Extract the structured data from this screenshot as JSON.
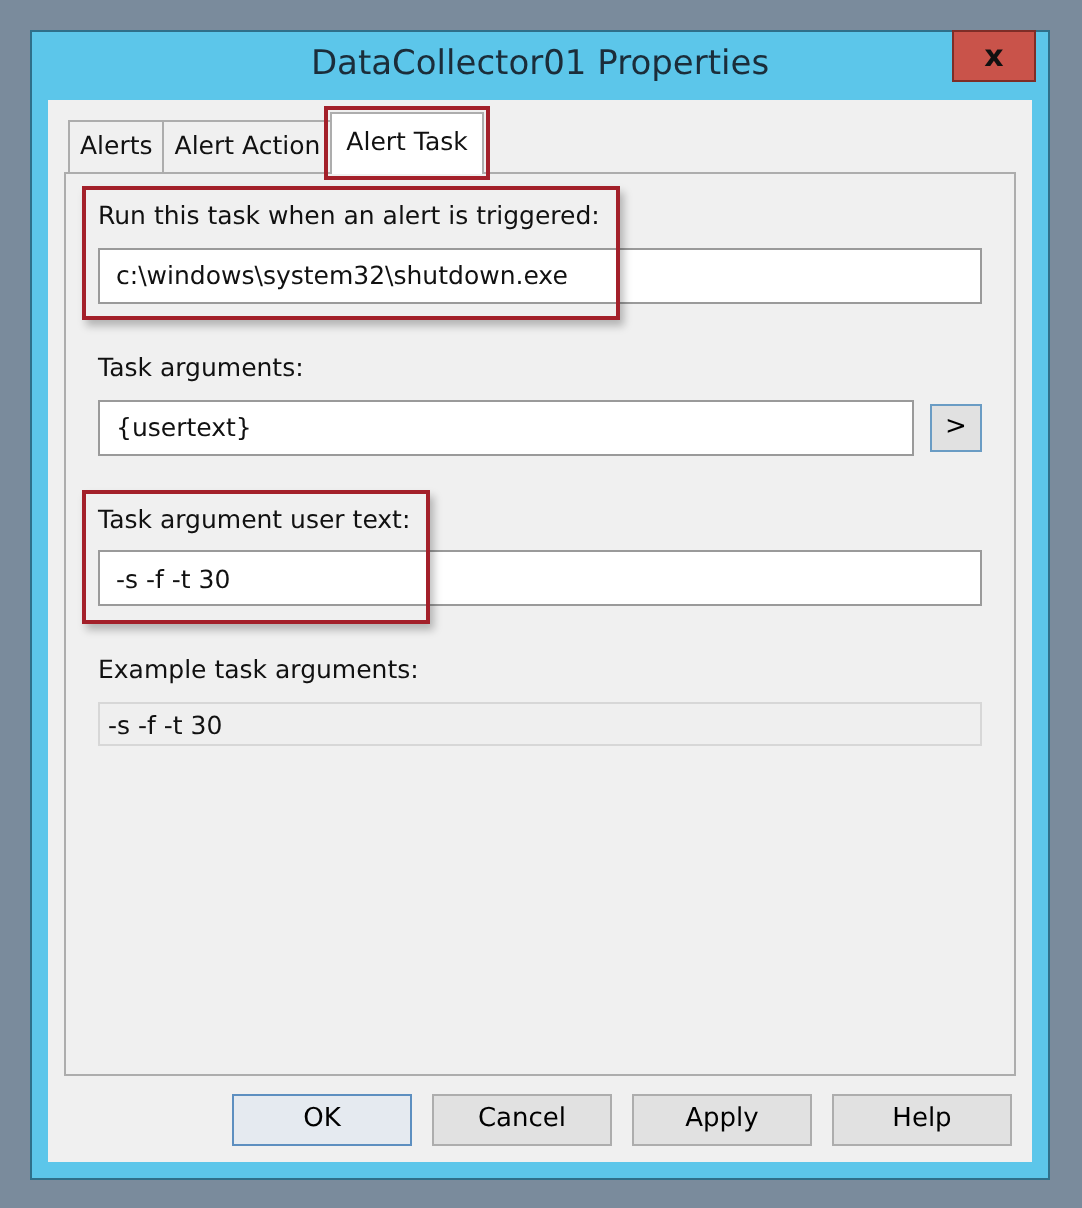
{
  "window": {
    "title": "DataCollector01 Properties",
    "close": "x"
  },
  "tabs": [
    {
      "label": "Alerts",
      "selected": false,
      "highlighted": false
    },
    {
      "label": "Alert Action",
      "selected": false,
      "highlighted": false
    },
    {
      "label": "Alert Task",
      "selected": true,
      "highlighted": true
    }
  ],
  "fields": [
    {
      "label": "Run this task when an alert is triggered:",
      "value": "c:\\windows\\system32\\shutdown.exe",
      "highlighted": true,
      "disabled": false
    },
    {
      "label": "Task arguments:",
      "value": "{usertext}",
      "highlighted": false,
      "disabled": false,
      "button": ">"
    },
    {
      "label": "Task argument user text:",
      "value": "-s -f -t 30",
      "highlighted": true,
      "disabled": false
    },
    {
      "label": "Example task arguments:",
      "value": "-s -f -t 30",
      "highlighted": false,
      "disabled": true
    }
  ],
  "buttons": [
    {
      "label": "OK",
      "default": true
    },
    {
      "label": "Cancel",
      "default": false
    },
    {
      "label": "Apply",
      "default": false
    },
    {
      "label": "Help",
      "default": false
    }
  ]
}
